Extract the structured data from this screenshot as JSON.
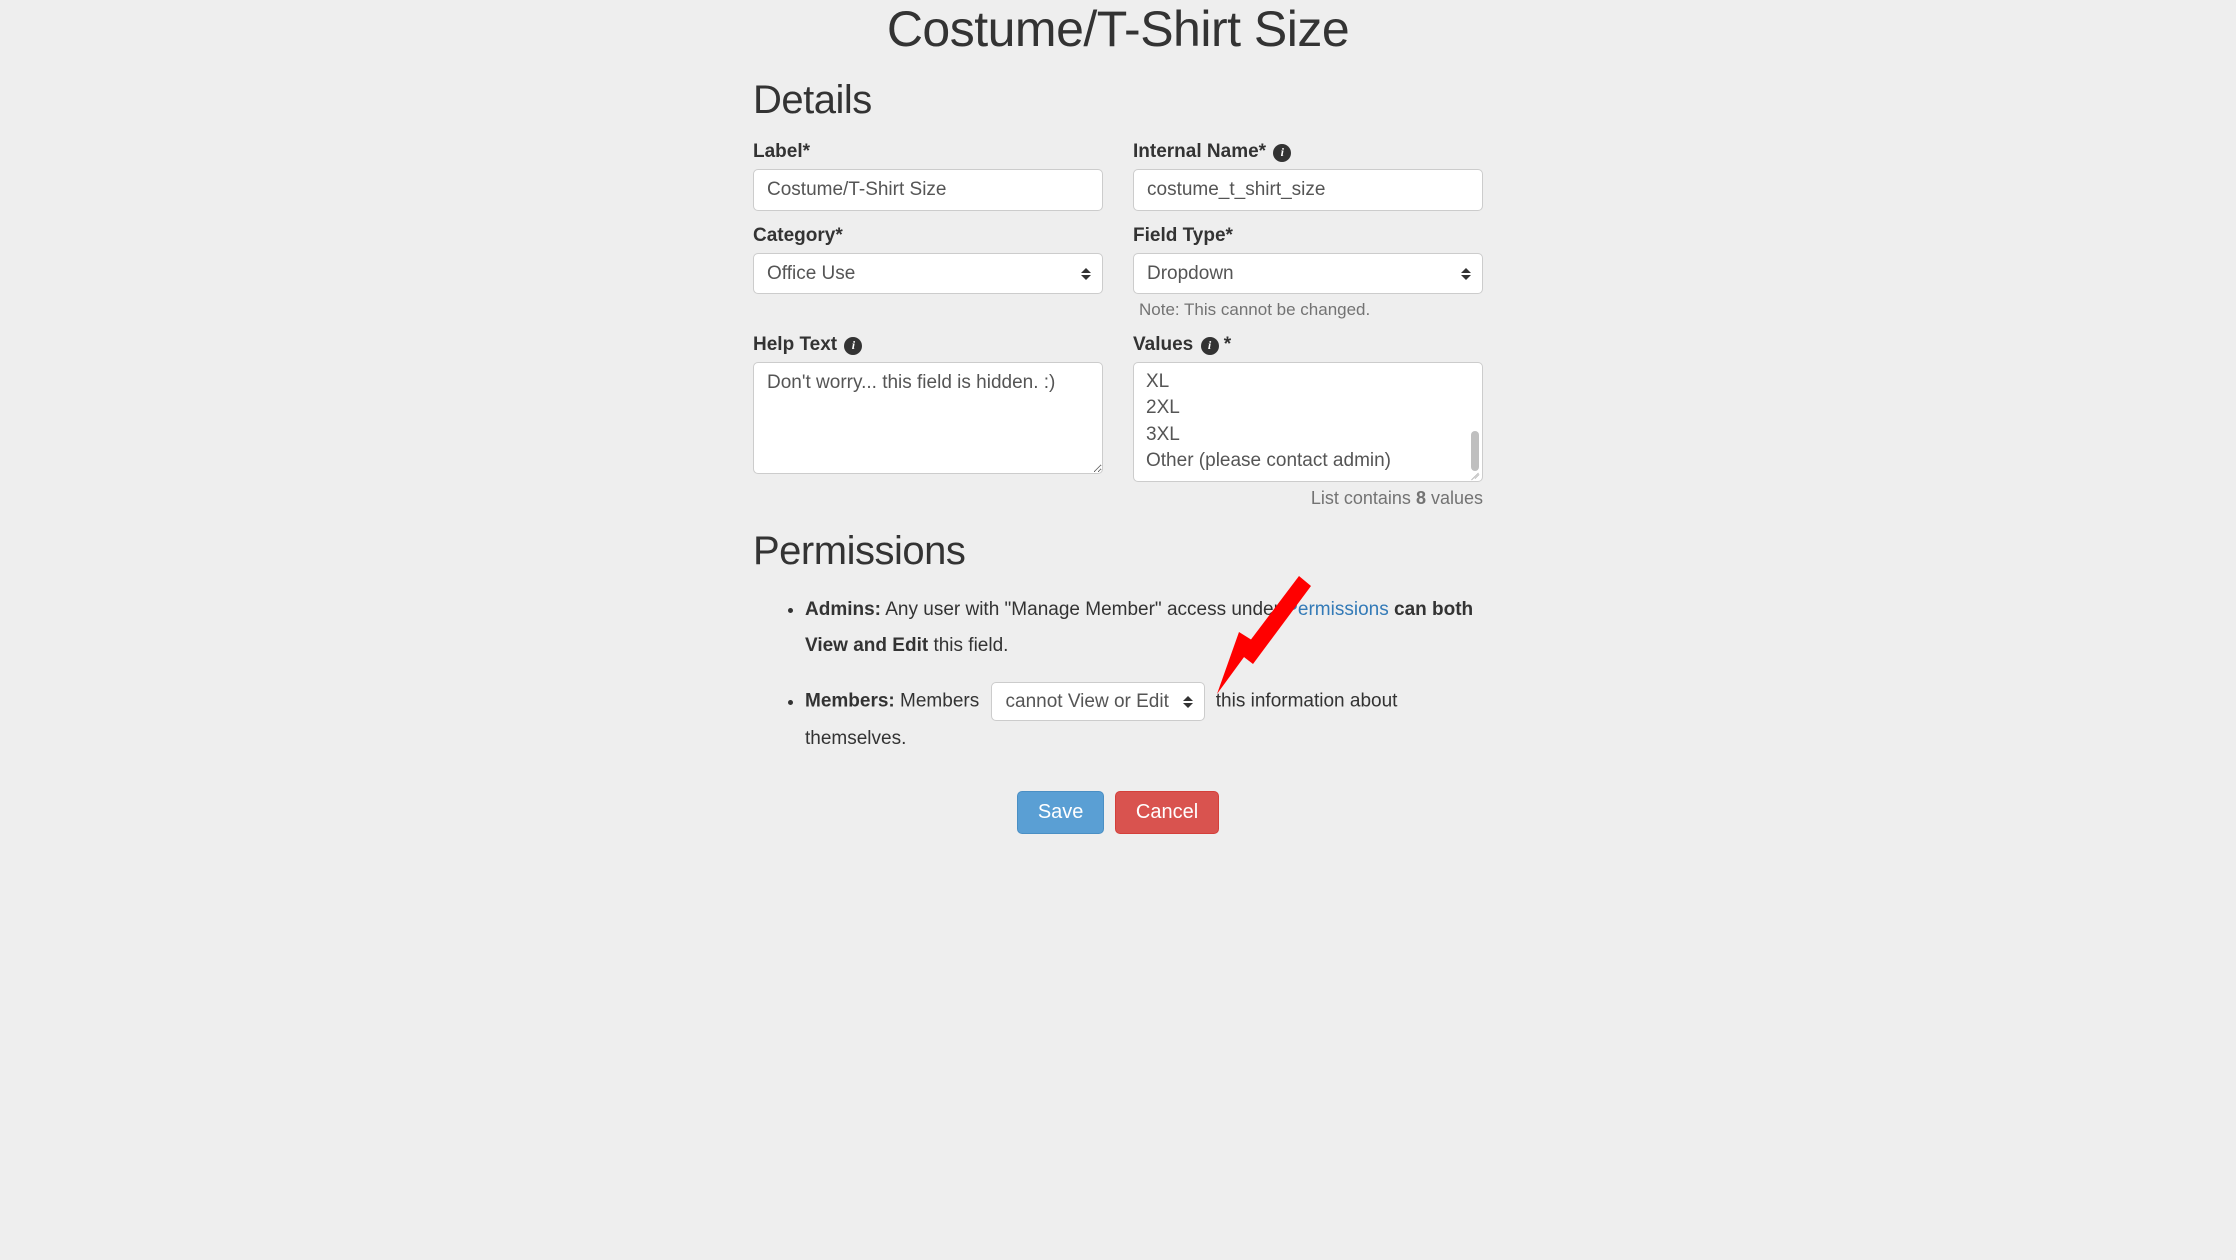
{
  "page_title": "Costume/T-Shirt Size",
  "details": {
    "heading": "Details",
    "label_field": {
      "label": "Label*",
      "value": "Costume/T-Shirt Size"
    },
    "internal_name_field": {
      "label": "Internal Name*",
      "value": "costume_t_shirt_size"
    },
    "category_field": {
      "label": "Category*",
      "selected": "Office Use"
    },
    "field_type_field": {
      "label": "Field Type*",
      "selected": "Dropdown",
      "note": "Note: This cannot be changed."
    },
    "help_text_field": {
      "label": "Help Text",
      "value": "Don't worry... this field is hidden. :)"
    },
    "values_field": {
      "label": "Values",
      "asterisk": " *",
      "visible_values": [
        "XL",
        "2XL",
        "3XL",
        "Other (please contact admin)"
      ],
      "count_prefix": "List contains ",
      "count": "8",
      "count_suffix": " values"
    }
  },
  "permissions": {
    "heading": "Permissions",
    "admins": {
      "label": "Admins:",
      "text_1": " Any user with \"Manage Member\" access under ",
      "link_text": "Permissions",
      "text_2": " ",
      "bold_1": "can both View and Edit",
      "text_3": " this field."
    },
    "members": {
      "label": "Members:",
      "text_1": " Members ",
      "select_value": "cannot View or Edit",
      "text_2": " this information about themselves."
    }
  },
  "buttons": {
    "save": "Save",
    "cancel": "Cancel"
  }
}
